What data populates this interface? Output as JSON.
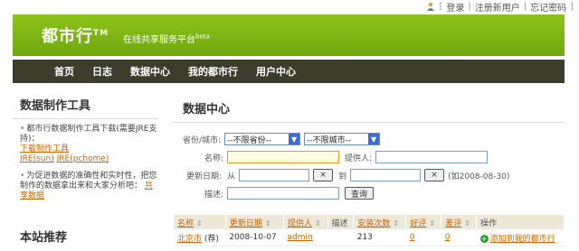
{
  "topbar": {
    "login": "登录",
    "register": "注册新用户",
    "forgot": "忘记密码"
  },
  "banner": {
    "brand": "都市行",
    "brand_tm": "TM",
    "tagline": "在线共享服务平台",
    "tagline_beta": "beta"
  },
  "nav": {
    "items": [
      "首页",
      "日志",
      "数据中心",
      "我的都市行",
      "用户中心"
    ]
  },
  "sidebar": {
    "title": "数据制作工具",
    "items": [
      {
        "text": "都市行数据制作工具下载(需要JRE支持)：",
        "links": [
          "下载制作工具",
          "JRE(sun)",
          "JRE(pchome)"
        ]
      },
      {
        "text": "为促进数据的准确性和实时性，把您制作的数据拿出来和大家分析吧：",
        "links": [
          "共享数据"
        ]
      }
    ],
    "title2": "本站推荐"
  },
  "main": {
    "title": "数据中心",
    "form": {
      "province_label": "省份/城市:",
      "province_value": "--不限省份--",
      "city_value": "--不限城市--",
      "name_label": "名称:",
      "provider_label": "提供人:",
      "date_label": "更新日期:",
      "from_label": "从",
      "to_label": "到",
      "clear_btn": "×",
      "date_hint": "(如2008-08-30)",
      "desc_label": "描述:",
      "search_btn": "查询"
    },
    "table": {
      "headers": [
        "名称",
        "更新日期",
        "提供人",
        "描述",
        "安装次数",
        "好评",
        "差评",
        "操作"
      ],
      "rows": [
        {
          "name": "北京市",
          "tag": "(荐)",
          "date": "2008-10-07",
          "provider": "admin",
          "desc": "",
          "installs": "213",
          "good": "0",
          "bad": "0",
          "action": "添加到我的都市行"
        }
      ]
    }
  }
}
